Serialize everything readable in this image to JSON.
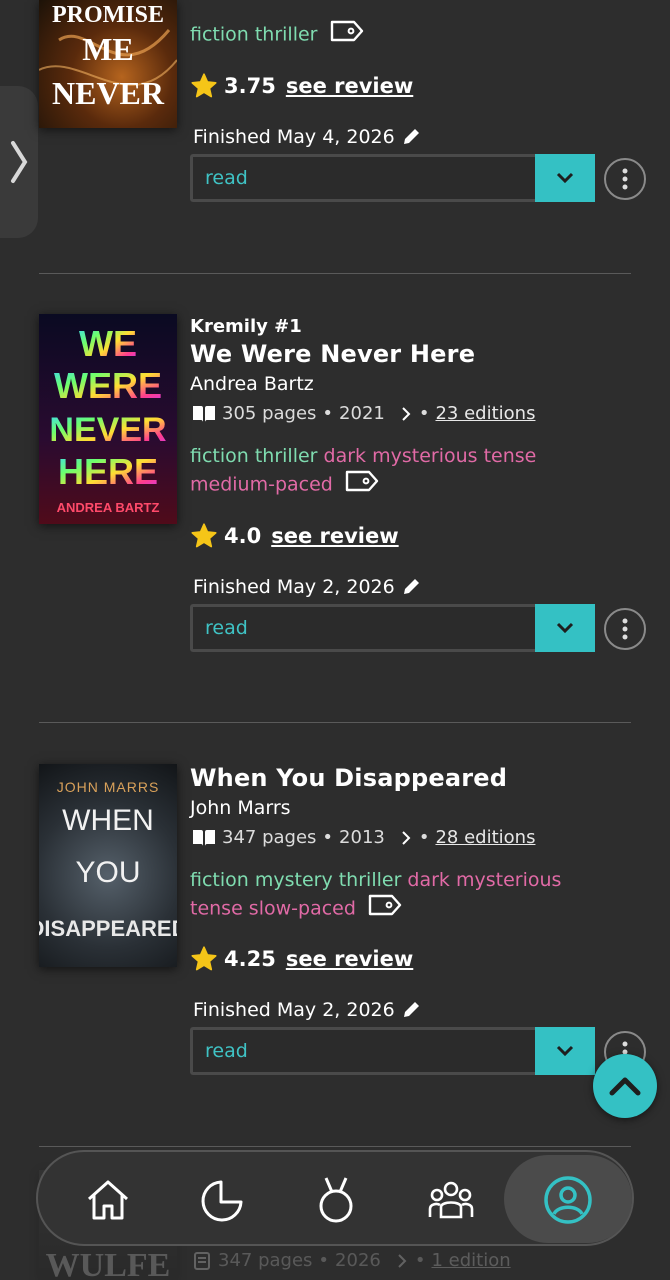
{
  "colors": {
    "accent": "#34c1c4",
    "genre_tag": "#7fdcb0",
    "mood_tag": "#e16aa6",
    "star": "#f5c518",
    "background": "#2d2d2d"
  },
  "books": [
    {
      "cover": {
        "line1": "PROMISE",
        "line2": "ME",
        "line3": "NEVER"
      },
      "tags_genre": "fiction thriller",
      "tags_mood": "",
      "rating": "3.75",
      "review_label": "see review",
      "finished": "Finished May 4, 2026",
      "status": "read"
    },
    {
      "series": "Kremily #1",
      "title": "We Were Never Here",
      "author": "Andrea Bartz",
      "pages": "305 pages",
      "year": "2021",
      "editions": "23 editions",
      "cover": {
        "line1": "WE",
        "line2": "WERE",
        "line3": "NEVER",
        "line4": "HERE",
        "author": "ANDREA BARTZ"
      },
      "tags_genre": "fiction thriller",
      "tags_mood": "dark mysterious tense medium-paced",
      "rating": "4.0",
      "review_label": "see review",
      "finished": "Finished May 2, 2026",
      "status": "read"
    },
    {
      "title": "When You Disappeared",
      "author": "John Marrs",
      "pages": "347 pages",
      "year": "2013",
      "editions": "28 editions",
      "cover": {
        "author": "JOHN MARRS",
        "line1": "WHEN",
        "line2": "YOU",
        "line3": "DISAPPEARED"
      },
      "tags_genre": "fiction mystery thriller",
      "tags_mood": "dark mysterious tense slow-paced",
      "rating": "4.25",
      "review_label": "see review",
      "finished": "Finished May 2, 2026",
      "status": "read"
    },
    {
      "pages": "347 pages",
      "year": "2026",
      "editions": "1 edition",
      "cover": {
        "line1": "WULFE"
      }
    }
  ],
  "nav": {
    "items": [
      {
        "icon": "home-icon"
      },
      {
        "icon": "stats-pie-icon"
      },
      {
        "icon": "challenge-medal-icon"
      },
      {
        "icon": "community-icon"
      },
      {
        "icon": "profile-icon"
      }
    ]
  }
}
